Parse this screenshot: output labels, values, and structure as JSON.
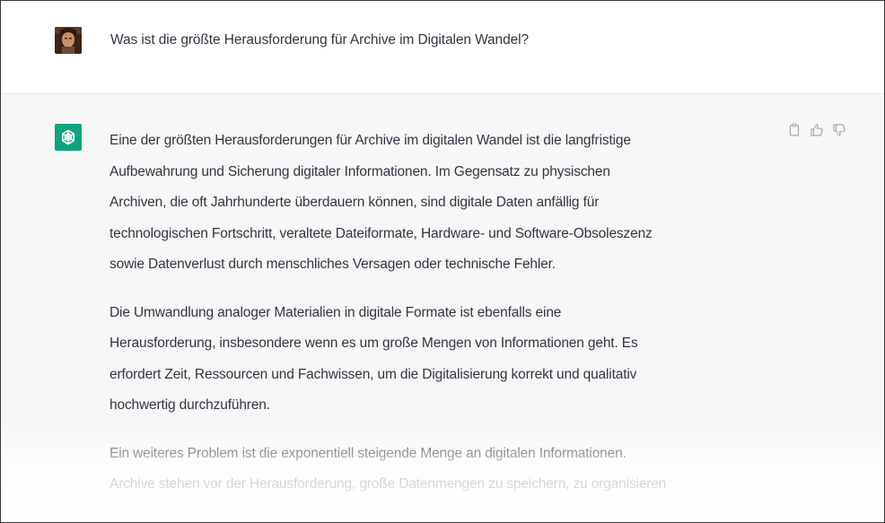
{
  "user_message": {
    "avatar_icon": "user-avatar",
    "text": "Was ist die größte Herausforderung für Archive im Digitalen Wandel?"
  },
  "assistant_message": {
    "logo_icon": "chatgpt-logo-icon",
    "accent_color": "#10a37f",
    "actions": [
      {
        "name": "copy-icon"
      },
      {
        "name": "thumbs-up-icon"
      },
      {
        "name": "thumbs-down-icon"
      }
    ],
    "paragraphs": [
      {
        "lines": [
          "Eine der größten Herausforderungen für Archive im digitalen Wandel ist die langfristige",
          "Aufbewahrung und Sicherung digitaler Informationen. Im Gegensatz zu physischen",
          "Archiven, die oft Jahrhunderte überdauern können, sind digitale Daten anfällig für",
          "technologischen Fortschritt, veraltete Dateiformate, Hardware- und Software-Obsoleszenz",
          "sowie Datenverlust durch menschliches Versagen oder technische Fehler."
        ]
      },
      {
        "lines": [
          "Die Umwandlung analoger Materialien in digitale Formate ist ebenfalls eine",
          "Herausforderung, insbesondere wenn es um große Mengen von Informationen geht. Es",
          "erfordert Zeit, Ressourcen und Fachwissen, um die Digitalisierung korrekt und qualitativ",
          "hochwertig durchzuführen."
        ]
      },
      {
        "lines": [
          "Ein weiteres Problem ist die exponentiell steigende Menge an digitalen Informationen.",
          "Archive stehen vor der Herausforderung, große Datenmengen zu speichern, zu organisieren"
        ]
      }
    ]
  }
}
